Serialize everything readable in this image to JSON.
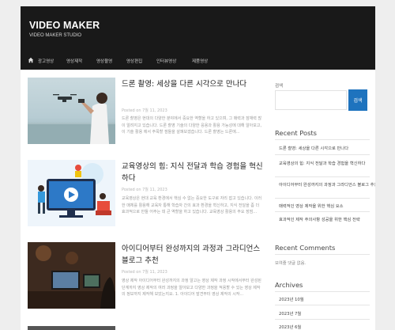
{
  "header": {
    "title": "VIDEO MAKER",
    "tagline": "VIDEO MAKER STUDIO"
  },
  "nav": {
    "home_icon": "home-icon",
    "items": [
      "광고영상",
      "영상제작",
      "영상촬영",
      "영상편집",
      "인터뷰영상",
      "제품영상"
    ]
  },
  "posts": [
    {
      "title": "드론 촬영: 세상을 다른 시각으로 만나다",
      "meta": "Posted on 7월 11, 2023",
      "excerpt": "드론 촬영은 현대의 다양한 분야에서 중요한 역할을 하고 있으며, 그 매력과 잠재력 많이 알려지고 있습니다. 드론 촬영 기술의 다양한 응용과 활용 가능성에 대해 알아보고, 이 기술 활용 에서 주목할 점들을 살펴보겠습니다. 드론 촬영는 드론에..."
    },
    {
      "title": "교육영상의 힘: 지식 전달과 학습 경험을 혁신하다",
      "meta": "Posted on 7월 11, 2023",
      "excerpt": "교육영상은 현대 교육 환경에서 핵심 수 없는 중요한 도구로 자리 잡고 있습니다. 이러한 매체를 활용해 교육자 통해 학습자 간의 효과 환경을 혁신하고, 지식 전달을 좀 더 효과적으로 만들 어주는 데 큰 역할을 하고 있습니다. 교육영상 활용의 주요 장점..."
    },
    {
      "title": "아이디어부터 완성까지의 과정과 그라디언스 블로그 추천",
      "meta": "Posted on 7월 11, 2023",
      "excerpt": "영상 제작 아이디어부터 완성까지의 과정 알고는 영상 제작 과정 시작에서부터 완성된 단계까지 영상 제작의 여러 과정을 알아보고 다양한 과정을 적용할 수 있는 영상 제작의 정보까지 제작해 보았는지요. 1. 아이디어 발견부터 영상 제작의 시작..."
    }
  ],
  "sidebar": {
    "search_label": "검색",
    "search_button": "검색",
    "recent_posts_heading": "Recent Posts",
    "recent_posts": [
      "드론 촬영: 세상을 다른 시각으로 만나다",
      "교육영상의 힘: 지식 전달과 학습 경험을 혁신하다",
      "아이디어부터 완성까지의 과정과 그라디언스 블로그 추천",
      "매력적인 영상 제작을 위한 핵심 요소",
      "효과적인 제작 주의사항 성공을 위한 핵심 전략"
    ],
    "recent_comments_heading": "Recent Comments",
    "recent_comments_text": "보여줄 댓글 없음.",
    "archives_heading": "Archives",
    "archives": [
      "2023년 10월",
      "2023년 7월",
      "2023년 6월"
    ]
  },
  "colors": {
    "header_bg": "#191919",
    "accent": "#1e73be"
  }
}
